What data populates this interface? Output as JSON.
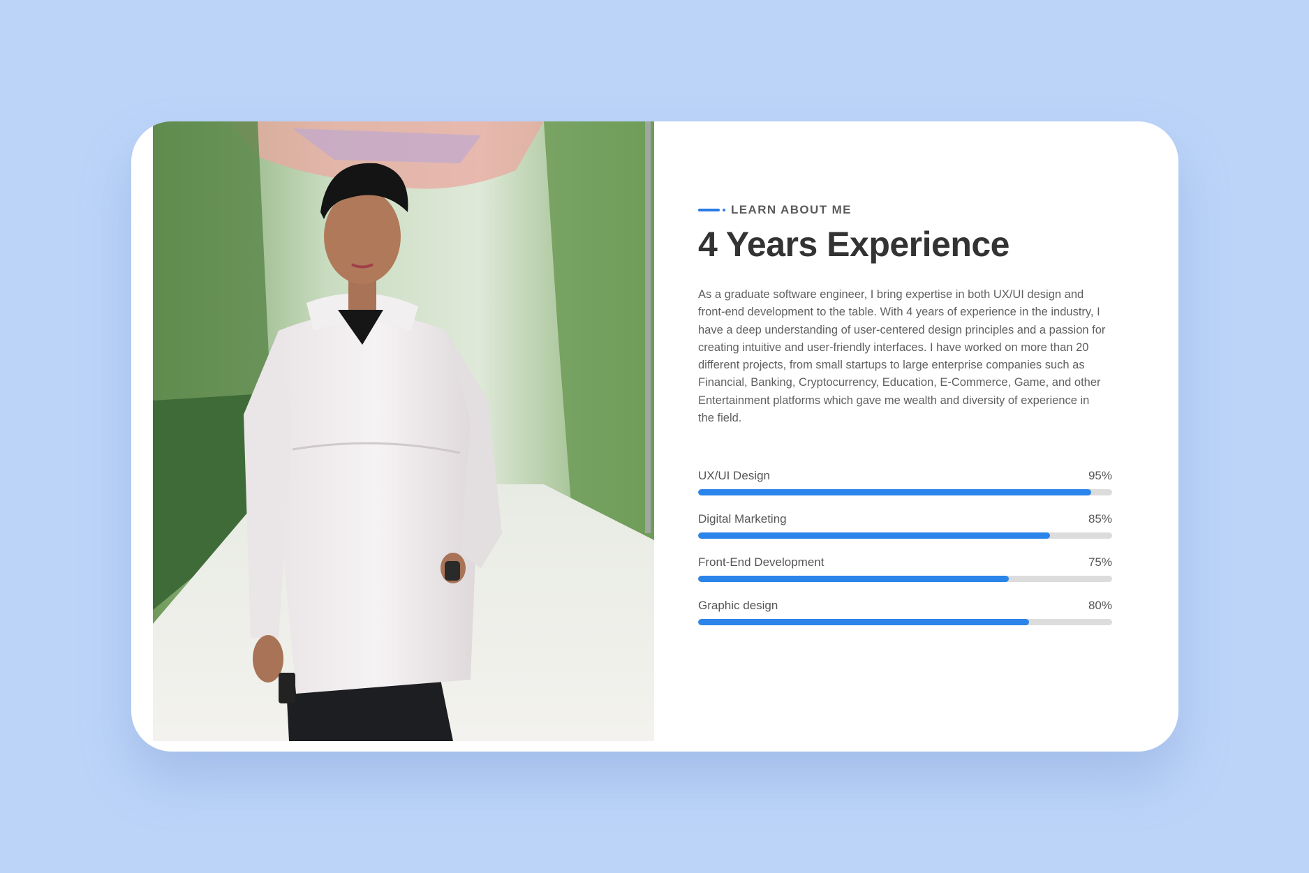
{
  "about": {
    "eyebrow": "LEARN ABOUT ME",
    "title": "4 Years Experience",
    "description": "As a graduate software engineer, I bring expertise in both UX/UI design and front-end development to the table. With 4 years of experience in the industry, I have a deep understanding of user-centered design principles and a passion for creating intuitive and user-friendly interfaces. I have worked on more than 20 different projects, from small startups to large enterprise companies such as Financial, Banking, Cryptocurrency, Education, E-Commerce, Game, and other Entertainment platforms which gave me wealth and diversity of experience in the field."
  },
  "skills": [
    {
      "label": "UX/UI Design",
      "percent_text": "95%",
      "value": 0.95
    },
    {
      "label": "Digital Marketing",
      "percent_text": "85%",
      "value": 0.85
    },
    {
      "label": "Front-End Development",
      "percent_text": "75%",
      "value": 0.75
    },
    {
      "label": "Graphic design",
      "percent_text": "80%",
      "value": 0.8
    }
  ],
  "colors": {
    "background": "#bcd4f8",
    "accent": "#2b84ea",
    "track": "#dcdcdc",
    "title": "#333333"
  },
  "photo": {
    "icon": "portrait-photo"
  }
}
